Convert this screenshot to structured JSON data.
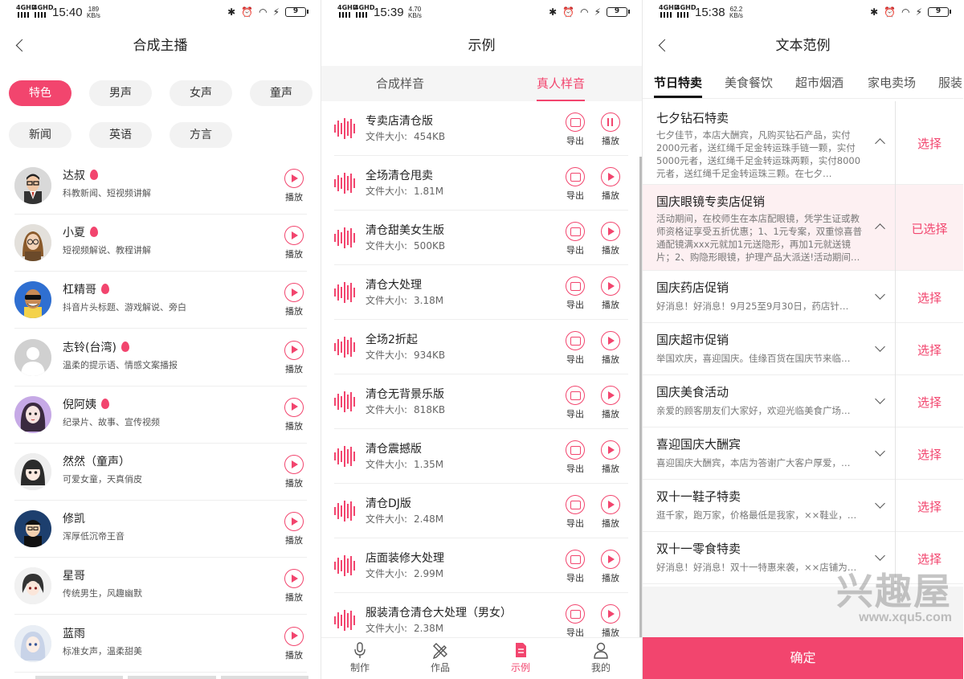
{
  "status_bars": [
    {
      "time": "15:40",
      "speed_value": "189",
      "speed_unit": "KB/s",
      "battery": "9",
      "net1": "4GHD",
      "net2": "4GHD"
    },
    {
      "time": "15:39",
      "speed_value": "4.70",
      "speed_unit": "KB/s",
      "battery": "9",
      "net1": "4GHD",
      "net2": "4GHD"
    },
    {
      "time": "15:38",
      "speed_value": "62.2",
      "speed_unit": "KB/s",
      "battery": "9",
      "net1": "4GHD",
      "net2": "4GHD"
    }
  ],
  "screen1": {
    "title": "合成主播",
    "filters": [
      "特色",
      "男声",
      "女声",
      "童声",
      "新闻",
      "英语",
      "方言"
    ],
    "active_filter": "特色",
    "play_label": "播放",
    "voices": [
      {
        "name": "达叔",
        "hot": true,
        "desc": "科教新闻、短视频讲解",
        "avatar": "man-glasses"
      },
      {
        "name": "小夏",
        "hot": true,
        "desc": "短视频解说、教程讲解",
        "avatar": "woman-glasses"
      },
      {
        "name": "杠精哥",
        "hot": true,
        "desc": "抖音片头标题、游戏解说、旁白",
        "avatar": "sunglasses-man"
      },
      {
        "name": "志铃(台湾)",
        "hot": true,
        "desc": "温柔的提示语、情感文案播报",
        "avatar": "default-user"
      },
      {
        "name": "倪阿姨",
        "hot": true,
        "desc": "纪录片、故事、宣传视频",
        "avatar": "anime-woman"
      },
      {
        "name": "然然（童声）",
        "hot": false,
        "desc": "可爱女童，天真俏皮",
        "avatar": "anime-girl"
      },
      {
        "name": "修凯",
        "hot": false,
        "desc": "浑厚低沉帝王音",
        "avatar": "cap-boy"
      },
      {
        "name": "星哥",
        "hot": false,
        "desc": "传统男生，风趣幽默",
        "avatar": "anime-boy"
      },
      {
        "name": "蓝雨",
        "hot": false,
        "desc": "标准女声，温柔甜美",
        "avatar": "anime-blue-girl"
      }
    ]
  },
  "screen2": {
    "title": "示例",
    "tabs": [
      "合成样音",
      "真人样音"
    ],
    "active_tab": "真人样音",
    "size_label": "文件大小:",
    "export_label": "导出",
    "play_label": "播放",
    "samples": [
      {
        "title": "专卖店清仓版",
        "size": "454KB",
        "playing": true
      },
      {
        "title": "全场清仓甩卖",
        "size": "1.81M",
        "playing": false
      },
      {
        "title": "清仓甜美女生版",
        "size": "500KB",
        "playing": false
      },
      {
        "title": "清仓大处理",
        "size": "3.18M",
        "playing": false
      },
      {
        "title": "全场2折起",
        "size": "934KB",
        "playing": false
      },
      {
        "title": "清仓无背景乐版",
        "size": "818KB",
        "playing": false
      },
      {
        "title": "清仓震撼版",
        "size": "1.35M",
        "playing": false
      },
      {
        "title": "清仓DJ版",
        "size": "2.48M",
        "playing": false
      },
      {
        "title": "店面装修大处理",
        "size": "2.99M",
        "playing": false
      },
      {
        "title": "服装清仓清仓大处理（男女）",
        "size": "2.38M",
        "playing": false
      }
    ],
    "nav": [
      {
        "label": "制作",
        "icon": "microphone-icon"
      },
      {
        "label": "作品",
        "icon": "pencil-ruler-icon"
      },
      {
        "label": "示例",
        "icon": "document-icon",
        "active": true
      },
      {
        "label": "我的",
        "icon": "person-icon"
      }
    ]
  },
  "screen3": {
    "title": "文本范例",
    "categories": [
      "节日特卖",
      "美食餐饮",
      "超市烟酒",
      "家电卖场",
      "服装"
    ],
    "active_category": "节日特卖",
    "select_label": "选择",
    "selected_label": "已选择",
    "confirm_label": "确定",
    "templates": [
      {
        "title": "七夕钻石特卖",
        "body": "七夕佳节，本店大酬宾，凡购买钻石产品，实付2000元者，送红绳千足金转运珠手链一颗，实付5000元者，送红绳千足金转运珠两颗，实付8000元者，送红绳千足金转运珠三颗。在七夕…",
        "expanded": true,
        "selected": false
      },
      {
        "title": "国庆眼镜专卖店促销",
        "body": "活动期间，在校师生在本店配眼镜，凭学生证或教师资格证享受五折优惠；1、1元专案，双重惊喜普通配镜满xxx元就加1元送隐形，再加1元就送镜片；2、购隐形眼镜，护理产品大派送!活动期间…",
        "expanded": true,
        "selected": true
      },
      {
        "title": "国庆药店促销",
        "body": "好消息！好消息！9月25至9月30日，药店针…",
        "expanded": false,
        "selected": false
      },
      {
        "title": "国庆超市促销",
        "body": "举国欢庆，喜迎国庆。佳缘百货在国庆节来临…",
        "expanded": false,
        "selected": false
      },
      {
        "title": "国庆美食活动",
        "body": "亲爱的顾客朋友们大家好，欢迎光临美食广场…",
        "expanded": false,
        "selected": false
      },
      {
        "title": "喜迎国庆大酬宾",
        "body": "喜迎国庆大酬宾，本店为答谢广大客户厚爱，…",
        "expanded": false,
        "selected": false
      },
      {
        "title": "双十一鞋子特卖",
        "body": "逛千家，跑万家，价格最低是我家，××鞋业，…",
        "expanded": false,
        "selected": false
      },
      {
        "title": "双十一零食特卖",
        "body": "好消息！好消息！双十一特惠来袭，××店铺为…",
        "expanded": false,
        "selected": false
      }
    ],
    "watermark": {
      "brand": "兴趣屋",
      "url": "www.xqu5.com"
    }
  },
  "colors": {
    "accent": "#f2456e",
    "text": "#222222",
    "muted": "#777777",
    "selected_bg": "#fdf0f2"
  }
}
